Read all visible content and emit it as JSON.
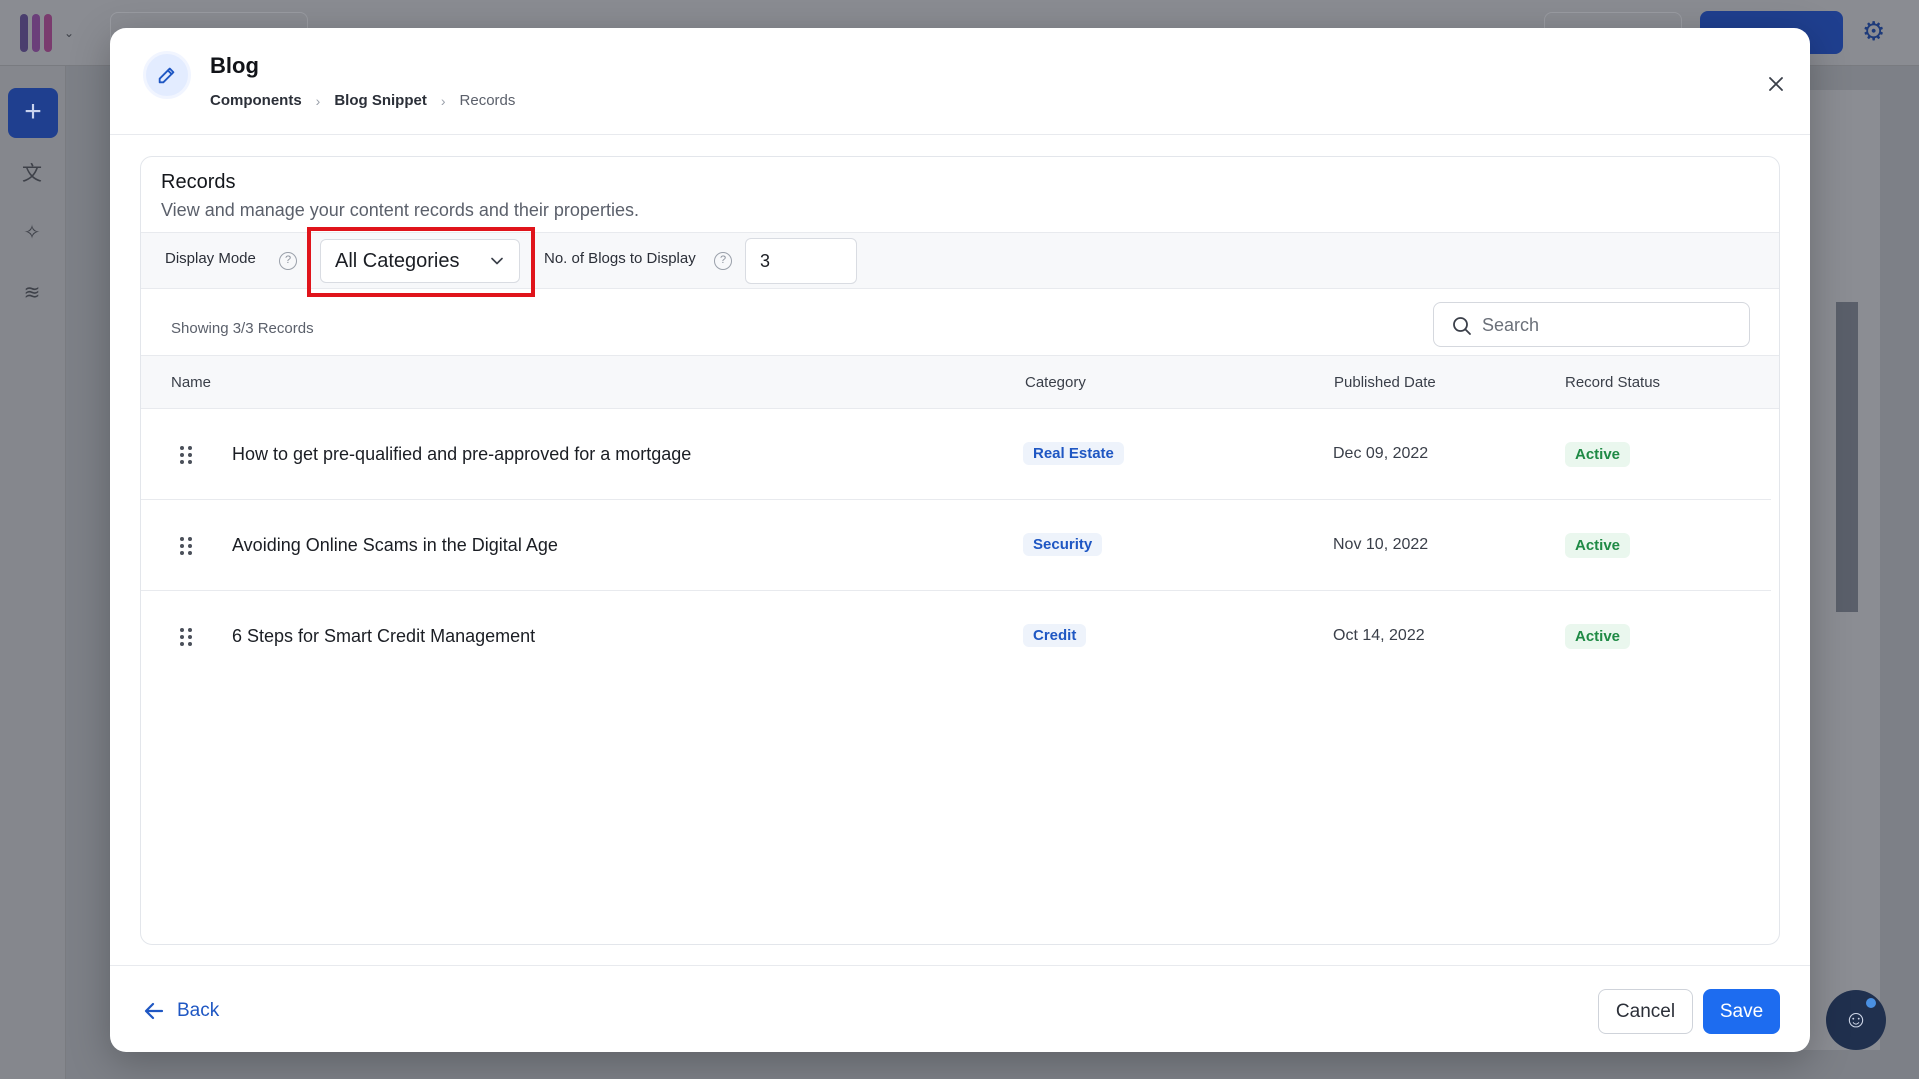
{
  "modal": {
    "title": "Blog",
    "breadcrumb": [
      "Components",
      "Blog Snippet",
      "Records"
    ]
  },
  "records_panel": {
    "title": "Records",
    "subtitle": "View and manage your content records and their properties.",
    "display_mode_label": "Display Mode",
    "display_mode_value": "All Categories",
    "num_blogs_label": "No. of Blogs to Display",
    "num_blogs_value": "3",
    "showing_text": "Showing 3/3 Records",
    "search_placeholder": "Search"
  },
  "table": {
    "columns": [
      "Name",
      "Category",
      "Published Date",
      "Record Status"
    ],
    "rows": [
      {
        "name": "How to get pre-qualified and pre-approved for a mortgage",
        "category": "Real Estate",
        "date": "Dec 09, 2022",
        "status": "Active"
      },
      {
        "name": "Avoiding Online Scams in the Digital Age",
        "category": "Security",
        "date": "Nov 10, 2022",
        "status": "Active"
      },
      {
        "name": "6 Steps for Smart Credit Management",
        "category": "Credit",
        "date": "Oct 14, 2022",
        "status": "Active"
      }
    ]
  },
  "footer": {
    "back_label": "Back",
    "cancel_label": "Cancel",
    "save_label": "Save"
  },
  "icons": {
    "header": "pencil-icon",
    "close": "close-icon",
    "help": "help-circle-icon",
    "search": "search-icon",
    "drag": "drag-handle-icon",
    "back": "arrow-left-icon"
  },
  "colors": {
    "accent": "#1d6cf0",
    "highlight": "#e0141b",
    "category_text": "#1f57c3",
    "status_text": "#1f8a45"
  }
}
